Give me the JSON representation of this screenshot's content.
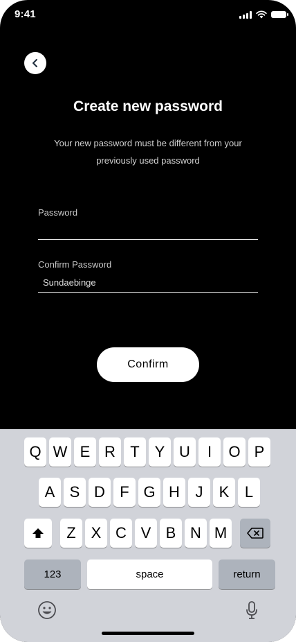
{
  "status_bar": {
    "time": "9:41"
  },
  "screen": {
    "title": "Create new password",
    "subtitle": "Your new password must be different from your previously used password"
  },
  "form": {
    "password": {
      "label": "Password",
      "value": ""
    },
    "confirm_password": {
      "label": "Confirm Password",
      "value": "Sundaebinge"
    },
    "confirm_button_label": "Confirm"
  },
  "keyboard": {
    "row1": [
      "Q",
      "W",
      "E",
      "R",
      "T",
      "Y",
      "U",
      "I",
      "O",
      "P"
    ],
    "row2": [
      "A",
      "S",
      "D",
      "F",
      "G",
      "H",
      "J",
      "K",
      "L"
    ],
    "row3": [
      "Z",
      "X",
      "C",
      "V",
      "B",
      "N",
      "M"
    ],
    "numbers_label": "123",
    "space_label": "space",
    "return_label": "return"
  },
  "colors": {
    "background": "#000000",
    "keyboard": "#d1d3d9",
    "special_key": "#adb3bc"
  }
}
